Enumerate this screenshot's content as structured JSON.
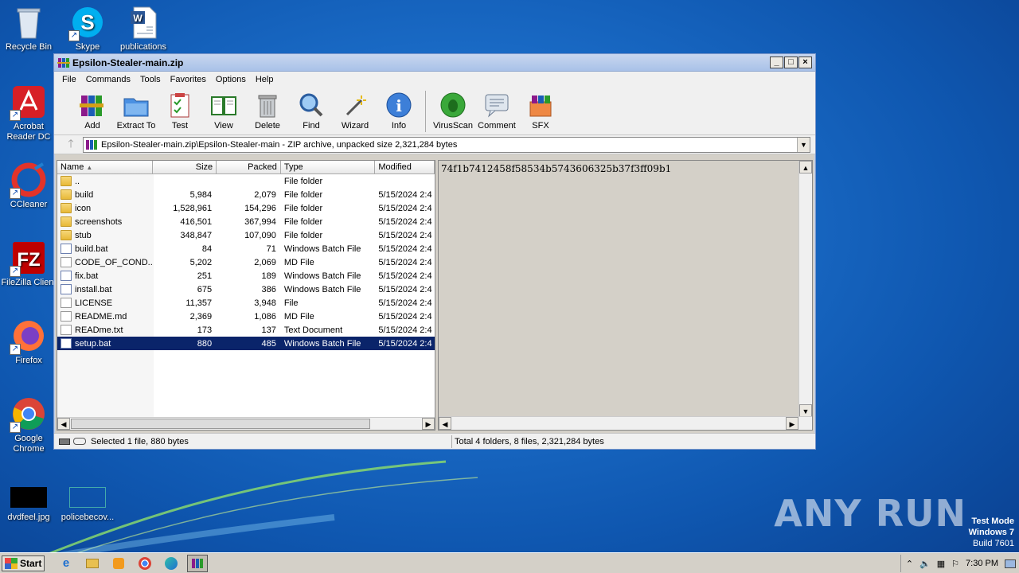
{
  "desktop": {
    "icons": [
      "Recycle Bin",
      "Skype",
      "publications",
      "Acrobat Reader DC",
      "CCleaner",
      "FileZilla Client",
      "Firefox",
      "Google Chrome",
      "dvdfeel.jpg",
      "policebecov..."
    ]
  },
  "window": {
    "title": "Epsilon-Stealer-main.zip",
    "menu": [
      "File",
      "Commands",
      "Tools",
      "Favorites",
      "Options",
      "Help"
    ],
    "toolbar": [
      "Add",
      "Extract To",
      "Test",
      "View",
      "Delete",
      "Find",
      "Wizard",
      "Info",
      "VirusScan",
      "Comment",
      "SFX"
    ],
    "address": "Epsilon-Stealer-main.zip\\Epsilon-Stealer-main - ZIP archive, unpacked size 2,321,284 bytes",
    "columns": [
      "Name",
      "Size",
      "Packed",
      "Type",
      "Modified"
    ],
    "files": [
      {
        "name": "..",
        "size": "",
        "packed": "",
        "type": "File folder",
        "modified": "",
        "icon": "folder"
      },
      {
        "name": "build",
        "size": "5,984",
        "packed": "2,079",
        "type": "File folder",
        "modified": "5/15/2024 2:4",
        "icon": "folder"
      },
      {
        "name": "icon",
        "size": "1,528,961",
        "packed": "154,296",
        "type": "File folder",
        "modified": "5/15/2024 2:4",
        "icon": "folder"
      },
      {
        "name": "screenshots",
        "size": "416,501",
        "packed": "367,994",
        "type": "File folder",
        "modified": "5/15/2024 2:4",
        "icon": "folder"
      },
      {
        "name": "stub",
        "size": "348,847",
        "packed": "107,090",
        "type": "File folder",
        "modified": "5/15/2024 2:4",
        "icon": "folder"
      },
      {
        "name": "build.bat",
        "size": "84",
        "packed": "71",
        "type": "Windows Batch File",
        "modified": "5/15/2024 2:4",
        "icon": "bat"
      },
      {
        "name": "CODE_OF_COND...",
        "size": "5,202",
        "packed": "2,069",
        "type": "MD File",
        "modified": "5/15/2024 2:4",
        "icon": "doc"
      },
      {
        "name": "fix.bat",
        "size": "251",
        "packed": "189",
        "type": "Windows Batch File",
        "modified": "5/15/2024 2:4",
        "icon": "bat"
      },
      {
        "name": "install.bat",
        "size": "675",
        "packed": "386",
        "type": "Windows Batch File",
        "modified": "5/15/2024 2:4",
        "icon": "bat"
      },
      {
        "name": "LICENSE",
        "size": "11,357",
        "packed": "3,948",
        "type": "File",
        "modified": "5/15/2024 2:4",
        "icon": "doc"
      },
      {
        "name": "README.md",
        "size": "2,369",
        "packed": "1,086",
        "type": "MD File",
        "modified": "5/15/2024 2:4",
        "icon": "doc"
      },
      {
        "name": "READme.txt",
        "size": "173",
        "packed": "137",
        "type": "Text Document",
        "modified": "5/15/2024 2:4",
        "icon": "doc"
      },
      {
        "name": "setup.bat",
        "size": "880",
        "packed": "485",
        "type": "Windows Batch File",
        "modified": "5/15/2024 2:4",
        "icon": "bat",
        "selected": true
      }
    ],
    "preview_text": "74f1b7412458f58534b5743606325b37f3ff09b1",
    "status_left": "Selected 1 file, 880 bytes",
    "status_right": "Total 4 folders, 8 files, 2,321,284 bytes"
  },
  "taskbar": {
    "start": "Start",
    "clock": "7:30 PM"
  },
  "watermark": {
    "brand": "ANY RUN",
    "mode": "Test Mode",
    "os": "Windows 7",
    "build": "Build 7601"
  },
  "colors": {
    "selection": "#0a246a",
    "desktop": "#1a6bc6",
    "window_bg": "#d4d0c8"
  }
}
